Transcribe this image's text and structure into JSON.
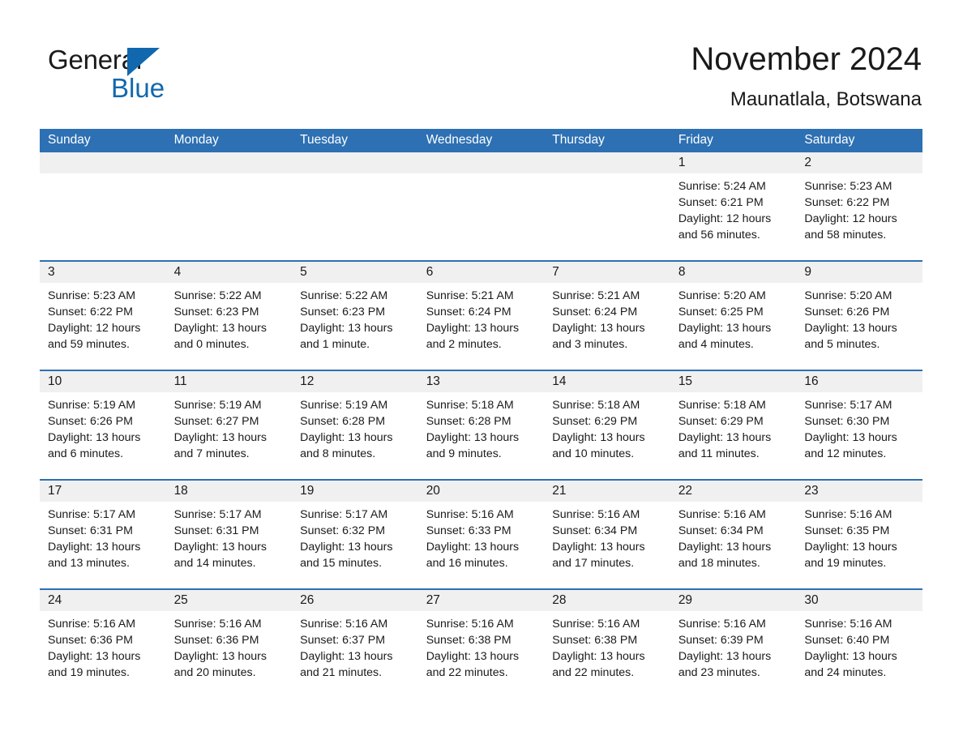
{
  "logo": {
    "word1": "General",
    "word2": "Blue",
    "triangle_color": "#1168ae",
    "blue_text_color": "#1168ae"
  },
  "header": {
    "month_title": "November 2024",
    "location": "Maunatlala, Botswana"
  },
  "theme": {
    "header_blue": "#2d70b3",
    "daynum_band": "#f0f0f0",
    "text": "#1a1a1a"
  },
  "weekday_headers": [
    "Sunday",
    "Monday",
    "Tuesday",
    "Wednesday",
    "Thursday",
    "Friday",
    "Saturday"
  ],
  "labels": {
    "sunrise_prefix": "Sunrise:",
    "sunset_prefix": "Sunset:",
    "daylight_prefix": "Daylight:"
  },
  "weeks": [
    [
      {
        "day": "",
        "empty": true
      },
      {
        "day": "",
        "empty": true
      },
      {
        "day": "",
        "empty": true
      },
      {
        "day": "",
        "empty": true
      },
      {
        "day": "",
        "empty": true
      },
      {
        "day": "1",
        "sunrise": "Sunrise: 5:24 AM",
        "sunset": "Sunset: 6:21 PM",
        "daylight_l1": "Daylight: 12 hours",
        "daylight_l2": "and 56 minutes."
      },
      {
        "day": "2",
        "sunrise": "Sunrise: 5:23 AM",
        "sunset": "Sunset: 6:22 PM",
        "daylight_l1": "Daylight: 12 hours",
        "daylight_l2": "and 58 minutes."
      }
    ],
    [
      {
        "day": "3",
        "sunrise": "Sunrise: 5:23 AM",
        "sunset": "Sunset: 6:22 PM",
        "daylight_l1": "Daylight: 12 hours",
        "daylight_l2": "and 59 minutes."
      },
      {
        "day": "4",
        "sunrise": "Sunrise: 5:22 AM",
        "sunset": "Sunset: 6:23 PM",
        "daylight_l1": "Daylight: 13 hours",
        "daylight_l2": "and 0 minutes."
      },
      {
        "day": "5",
        "sunrise": "Sunrise: 5:22 AM",
        "sunset": "Sunset: 6:23 PM",
        "daylight_l1": "Daylight: 13 hours",
        "daylight_l2": "and 1 minute."
      },
      {
        "day": "6",
        "sunrise": "Sunrise: 5:21 AM",
        "sunset": "Sunset: 6:24 PM",
        "daylight_l1": "Daylight: 13 hours",
        "daylight_l2": "and 2 minutes."
      },
      {
        "day": "7",
        "sunrise": "Sunrise: 5:21 AM",
        "sunset": "Sunset: 6:24 PM",
        "daylight_l1": "Daylight: 13 hours",
        "daylight_l2": "and 3 minutes."
      },
      {
        "day": "8",
        "sunrise": "Sunrise: 5:20 AM",
        "sunset": "Sunset: 6:25 PM",
        "daylight_l1": "Daylight: 13 hours",
        "daylight_l2": "and 4 minutes."
      },
      {
        "day": "9",
        "sunrise": "Sunrise: 5:20 AM",
        "sunset": "Sunset: 6:26 PM",
        "daylight_l1": "Daylight: 13 hours",
        "daylight_l2": "and 5 minutes."
      }
    ],
    [
      {
        "day": "10",
        "sunrise": "Sunrise: 5:19 AM",
        "sunset": "Sunset: 6:26 PM",
        "daylight_l1": "Daylight: 13 hours",
        "daylight_l2": "and 6 minutes."
      },
      {
        "day": "11",
        "sunrise": "Sunrise: 5:19 AM",
        "sunset": "Sunset: 6:27 PM",
        "daylight_l1": "Daylight: 13 hours",
        "daylight_l2": "and 7 minutes."
      },
      {
        "day": "12",
        "sunrise": "Sunrise: 5:19 AM",
        "sunset": "Sunset: 6:28 PM",
        "daylight_l1": "Daylight: 13 hours",
        "daylight_l2": "and 8 minutes."
      },
      {
        "day": "13",
        "sunrise": "Sunrise: 5:18 AM",
        "sunset": "Sunset: 6:28 PM",
        "daylight_l1": "Daylight: 13 hours",
        "daylight_l2": "and 9 minutes."
      },
      {
        "day": "14",
        "sunrise": "Sunrise: 5:18 AM",
        "sunset": "Sunset: 6:29 PM",
        "daylight_l1": "Daylight: 13 hours",
        "daylight_l2": "and 10 minutes."
      },
      {
        "day": "15",
        "sunrise": "Sunrise: 5:18 AM",
        "sunset": "Sunset: 6:29 PM",
        "daylight_l1": "Daylight: 13 hours",
        "daylight_l2": "and 11 minutes."
      },
      {
        "day": "16",
        "sunrise": "Sunrise: 5:17 AM",
        "sunset": "Sunset: 6:30 PM",
        "daylight_l1": "Daylight: 13 hours",
        "daylight_l2": "and 12 minutes."
      }
    ],
    [
      {
        "day": "17",
        "sunrise": "Sunrise: 5:17 AM",
        "sunset": "Sunset: 6:31 PM",
        "daylight_l1": "Daylight: 13 hours",
        "daylight_l2": "and 13 minutes."
      },
      {
        "day": "18",
        "sunrise": "Sunrise: 5:17 AM",
        "sunset": "Sunset: 6:31 PM",
        "daylight_l1": "Daylight: 13 hours",
        "daylight_l2": "and 14 minutes."
      },
      {
        "day": "19",
        "sunrise": "Sunrise: 5:17 AM",
        "sunset": "Sunset: 6:32 PM",
        "daylight_l1": "Daylight: 13 hours",
        "daylight_l2": "and 15 minutes."
      },
      {
        "day": "20",
        "sunrise": "Sunrise: 5:16 AM",
        "sunset": "Sunset: 6:33 PM",
        "daylight_l1": "Daylight: 13 hours",
        "daylight_l2": "and 16 minutes."
      },
      {
        "day": "21",
        "sunrise": "Sunrise: 5:16 AM",
        "sunset": "Sunset: 6:34 PM",
        "daylight_l1": "Daylight: 13 hours",
        "daylight_l2": "and 17 minutes."
      },
      {
        "day": "22",
        "sunrise": "Sunrise: 5:16 AM",
        "sunset": "Sunset: 6:34 PM",
        "daylight_l1": "Daylight: 13 hours",
        "daylight_l2": "and 18 minutes."
      },
      {
        "day": "23",
        "sunrise": "Sunrise: 5:16 AM",
        "sunset": "Sunset: 6:35 PM",
        "daylight_l1": "Daylight: 13 hours",
        "daylight_l2": "and 19 minutes."
      }
    ],
    [
      {
        "day": "24",
        "sunrise": "Sunrise: 5:16 AM",
        "sunset": "Sunset: 6:36 PM",
        "daylight_l1": "Daylight: 13 hours",
        "daylight_l2": "and 19 minutes."
      },
      {
        "day": "25",
        "sunrise": "Sunrise: 5:16 AM",
        "sunset": "Sunset: 6:36 PM",
        "daylight_l1": "Daylight: 13 hours",
        "daylight_l2": "and 20 minutes."
      },
      {
        "day": "26",
        "sunrise": "Sunrise: 5:16 AM",
        "sunset": "Sunset: 6:37 PM",
        "daylight_l1": "Daylight: 13 hours",
        "daylight_l2": "and 21 minutes."
      },
      {
        "day": "27",
        "sunrise": "Sunrise: 5:16 AM",
        "sunset": "Sunset: 6:38 PM",
        "daylight_l1": "Daylight: 13 hours",
        "daylight_l2": "and 22 minutes."
      },
      {
        "day": "28",
        "sunrise": "Sunrise: 5:16 AM",
        "sunset": "Sunset: 6:38 PM",
        "daylight_l1": "Daylight: 13 hours",
        "daylight_l2": "and 22 minutes."
      },
      {
        "day": "29",
        "sunrise": "Sunrise: 5:16 AM",
        "sunset": "Sunset: 6:39 PM",
        "daylight_l1": "Daylight: 13 hours",
        "daylight_l2": "and 23 minutes."
      },
      {
        "day": "30",
        "sunrise": "Sunrise: 5:16 AM",
        "sunset": "Sunset: 6:40 PM",
        "daylight_l1": "Daylight: 13 hours",
        "daylight_l2": "and 24 minutes."
      }
    ]
  ]
}
